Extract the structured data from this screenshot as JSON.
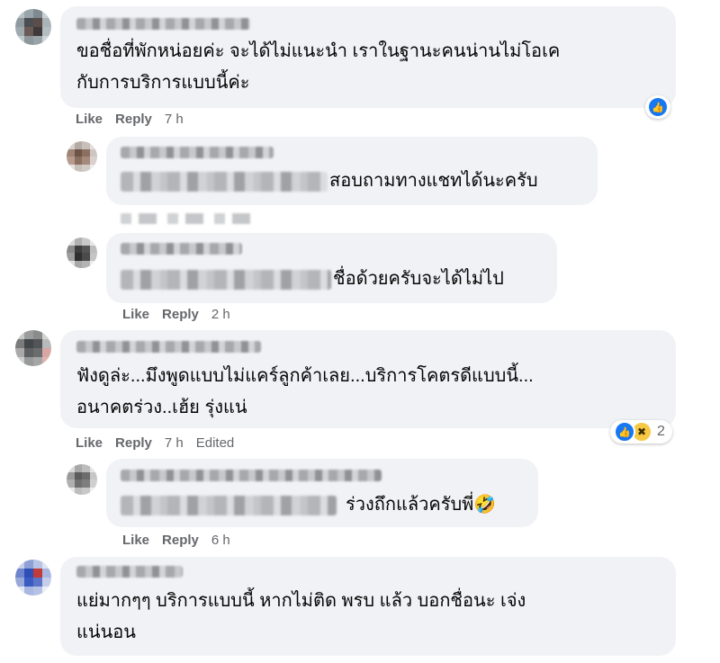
{
  "comments": [
    {
      "text_lines": [
        "ขอชื่อที่พักหน่อยค่ะ จะได้ไม่แนะนำ เราในฐานะคนน่านไม่โอเค",
        "กับการบริการแบบนี้ค่ะ"
      ],
      "like": "Like",
      "reply": "Reply",
      "time": "7 h",
      "reaction_count": ""
    },
    {
      "text_lines": [
        "สอบถามทางแชทได้นะครับ"
      ]
    },
    {
      "text_lines": [
        "ชื่อด้วยครับจะได้ไม่ไป"
      ],
      "like": "Like",
      "reply": "Reply",
      "time": "2 h"
    },
    {
      "text_lines": [
        "ฟังดูล่ะ...มึงพูดแบบไม่แคร์ลูกค้าเลย...บริการโคตรดีแบบนี้...",
        "อนาคตร่วง..เฮ้ย รุ่งแน่"
      ],
      "like": "Like",
      "reply": "Reply",
      "time": "7 h",
      "edited": "Edited",
      "reaction_count": "2"
    },
    {
      "text_lines": [
        "ร่วงถึกแล้วครับพี่🤣"
      ],
      "like": "Like",
      "reply": "Reply",
      "time": "6 h"
    },
    {
      "text_lines": [
        "แย่มากๆๆ บริการแบบนี้ หากไม่ติด พรบ แล้ว บอกชื่อนะ เจ่ง",
        "แน่นอน"
      ]
    }
  ],
  "icons": {
    "like": "like-icon",
    "haha": "haha-icon"
  },
  "colors": {
    "bubble": "#f0f2f5",
    "meta_text": "#65676b",
    "like_blue": "#1877f2"
  }
}
